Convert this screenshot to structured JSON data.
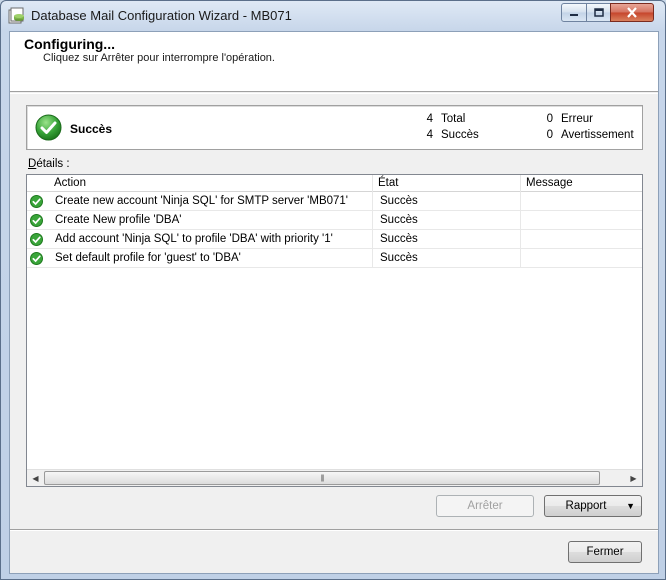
{
  "window": {
    "title": "Database Mail Configuration Wizard - MB071"
  },
  "header": {
    "title": "Configuring...",
    "subtitle": "Cliquez sur Arrêter pour interrompre l'opération."
  },
  "summary": {
    "status": "Succès",
    "total_count": "4",
    "total_label": "Total",
    "success_count": "4",
    "success_label": "Succès",
    "error_count": "0",
    "error_label": "Erreur",
    "warning_count": "0",
    "warning_label": "Avertissement"
  },
  "details": {
    "label_prefix": "D",
    "label_rest": "étails :",
    "columns": {
      "action": "Action",
      "state": "État",
      "message": "Message"
    },
    "rows": [
      {
        "icon": "success-check-icon",
        "action": "Create new account 'Ninja SQL' for SMTP server 'MB071'",
        "state": "Succès",
        "message": ""
      },
      {
        "icon": "success-check-icon",
        "action": "Create New profile 'DBA'",
        "state": "Succès",
        "message": ""
      },
      {
        "icon": "success-check-icon",
        "action": "Add account 'Ninja SQL' to profile 'DBA' with priority '1'",
        "state": "Succès",
        "message": ""
      },
      {
        "icon": "success-check-icon",
        "action": "Set default profile for 'guest' to 'DBA'",
        "state": "Succès",
        "message": ""
      }
    ]
  },
  "buttons": {
    "stop": "Arrêter",
    "report": "Rapport",
    "close": "Fermer"
  },
  "colors": {
    "success_green": "#3aa53a",
    "title_bar": "#c7d6ea",
    "close_button": "#c6442b"
  }
}
